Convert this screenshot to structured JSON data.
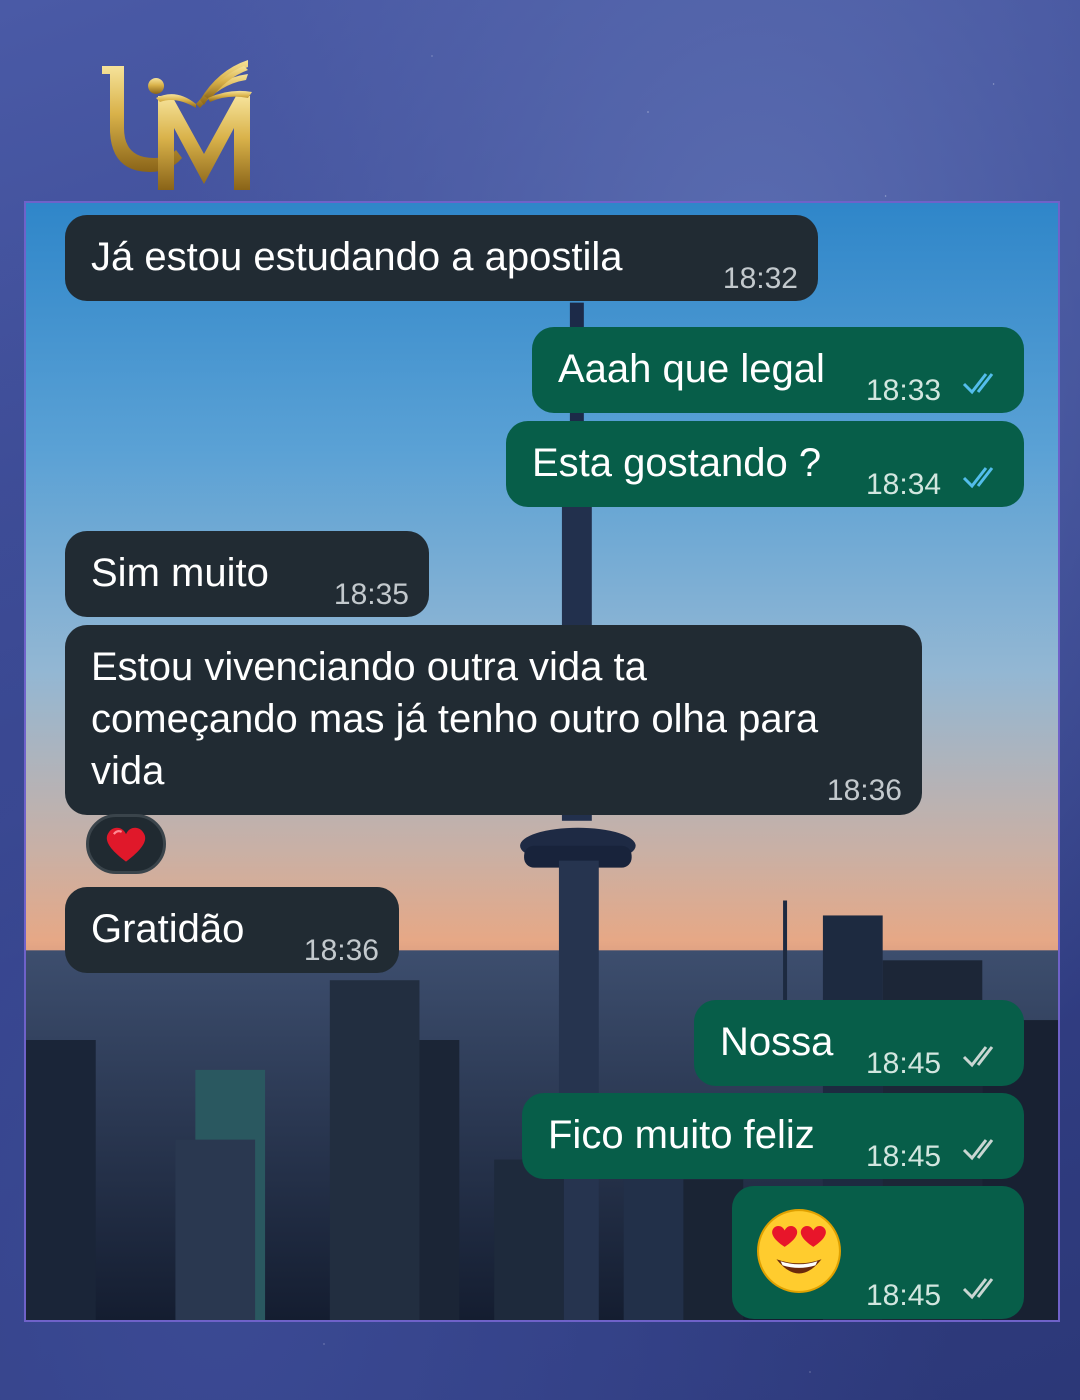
{
  "brand": {
    "logo_text": "UM"
  },
  "chat": {
    "messages": [
      {
        "side": "in",
        "text": "Já estou estudando a apostila",
        "time": "18:32"
      },
      {
        "side": "out",
        "text": "Aaah que legal",
        "time": "18:33",
        "status": "read"
      },
      {
        "side": "out",
        "text": "Esta gostando ?",
        "time": "18:34",
        "status": "read"
      },
      {
        "side": "in",
        "text": "Sim muito",
        "time": "18:35"
      },
      {
        "side": "in",
        "lines": [
          "Estou vivenciando outra vida ta",
          "começando mas já tenho outro olha para",
          "vida"
        ],
        "time": "18:36",
        "reaction": "red-heart"
      },
      {
        "side": "in",
        "text": "Gratidão",
        "time": "18:36"
      },
      {
        "side": "out",
        "text": "Nossa",
        "time": "18:45",
        "status": "read"
      },
      {
        "side": "out",
        "text": "Fico muito feliz",
        "time": "18:45",
        "status": "read"
      },
      {
        "side": "out",
        "emoji": "smiling-face-with-heart-eyes",
        "time": "18:45",
        "status": "read"
      }
    ]
  },
  "colors": {
    "incoming_bubble": "#212b33",
    "outgoing_bubble": "#075e49",
    "read_ticks": "#53bdeb",
    "frame_border": "#6f62c9",
    "logo_gold": "#d9b24a"
  }
}
